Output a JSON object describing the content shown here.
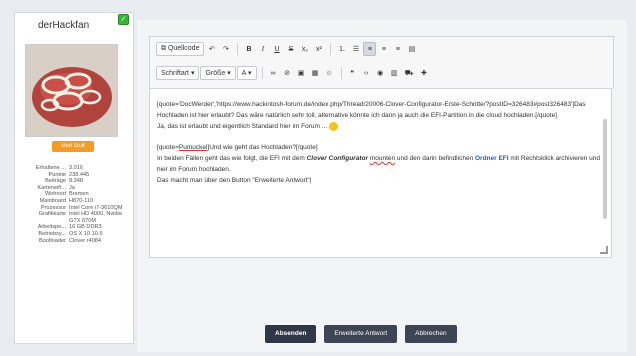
{
  "user": {
    "name": "derHackfan",
    "badge": "Mett Stuff",
    "online_glyph": "✓"
  },
  "stats": [
    {
      "k": "Erhaltene ...",
      "v": "3.016"
    },
    {
      "k": "Punkte",
      "v": "238.445"
    },
    {
      "k": "Beiträge",
      "v": "8.348"
    },
    {
      "k": "Karteneiñ...",
      "v": "Ja"
    },
    {
      "k": "Wohnort",
      "v": "Bremen"
    },
    {
      "k": "Mainboard",
      "v": "H870-110"
    },
    {
      "k": "Prozessor",
      "v": "Intel Core i7-3610QM"
    },
    {
      "k": "Grafikkarte",
      "v": "Intel HD 4000, Nvidia GTX 670M"
    },
    {
      "k": "Arbeitspe...",
      "v": "16 GB DDR3"
    },
    {
      "k": "Betriebsy...",
      "v": "OS X 10.10.5"
    },
    {
      "k": "Bootloader",
      "v": "Clover r4084"
    }
  ],
  "toolbar": {
    "row1": [
      {
        "name": "source-code-button",
        "label": "⧉ Quellcode",
        "boxed": true
      },
      {
        "name": "undo-button",
        "label": "↶"
      },
      {
        "name": "redo-button",
        "label": "↷"
      },
      {
        "sep": true
      },
      {
        "name": "bold-button",
        "label": "B",
        "style": "font-weight:bold"
      },
      {
        "name": "italic-button",
        "label": "I",
        "style": "font-style:italic;font-family:'Liberation Serif',serif"
      },
      {
        "name": "underline-button",
        "label": "U",
        "style": "text-decoration:underline"
      },
      {
        "name": "strikethrough-button",
        "label": "S",
        "style": "text-decoration:line-through"
      },
      {
        "name": "subscript-button",
        "label": "x₂"
      },
      {
        "name": "superscript-button",
        "label": "x²"
      },
      {
        "sep": true
      },
      {
        "name": "ordered-list-button",
        "label": "⒈"
      },
      {
        "name": "unordered-list-button",
        "label": "☰"
      },
      {
        "name": "align-left-button",
        "label": "≡",
        "active": true
      },
      {
        "name": "align-center-button",
        "label": "≡"
      },
      {
        "name": "align-right-button",
        "label": "≡"
      },
      {
        "name": "align-justify-button",
        "label": "▤"
      }
    ],
    "row2": [
      {
        "name": "font-family-select",
        "label": "Schriftart ▾",
        "boxed": true
      },
      {
        "name": "font-size-select",
        "label": "Größe ▾",
        "boxed": true
      },
      {
        "name": "text-color-button",
        "label": "A ▾",
        "boxed": true
      },
      {
        "sep": true
      },
      {
        "name": "link-icon",
        "label": "∞"
      },
      {
        "name": "unlink-icon",
        "label": "⊘"
      },
      {
        "name": "image-icon",
        "label": "▣"
      },
      {
        "name": "table-icon",
        "label": "▦"
      },
      {
        "name": "emoji-icon",
        "label": "☺"
      },
      {
        "sep": true
      },
      {
        "name": "quote-icon",
        "label": "❝"
      },
      {
        "name": "code-icon",
        "label": "‹›"
      },
      {
        "name": "spoiler-icon",
        "label": "◉"
      },
      {
        "name": "tabmenu-icon",
        "label": "▥"
      },
      {
        "name": "cart-icon",
        "label": "⛟"
      },
      {
        "name": "media-icon",
        "label": "✚"
      }
    ]
  },
  "editor": {
    "p1": "[quote='DocWerder','https://www.hackintosh-forum.de/index.php/Thread/20006-Clover-Configurator-Erste-Schritte/?postID=326483#post326483']Das Hochladen ist hier erlaubt? Das wäre natürlich sehr toll, alternative könnte ich dann ja auch die EFI-Partition in die cloud hochladen.[/quote]",
    "p2": "Ja, das ist erlaubt und eigentlich Standard hier im Forum ...",
    "p3_pre": "[quote=",
    "p3_mention": "Pumuckel",
    "p3_post": "]Und wie geht das Hochladen?[/quote]",
    "p4_a": "In beiden Fällen geht das wie folgt, die EFI mit dem ",
    "p4_b": "Clover Configurator",
    "p4_c": " ",
    "p4_d": "mounten",
    "p4_e": " und den darin befindlichen ",
    "p4_f": "Ordner EFI",
    "p4_g": " mit Rechtsklick archivieren und hier im Forum hochladen.",
    "p5": "Das macht man über den Button \"Erweiterte Antwort\"|"
  },
  "actions": {
    "submit": "Absenden",
    "extended": "Erweiterte Antwort",
    "cancel": "Abbrechen"
  }
}
